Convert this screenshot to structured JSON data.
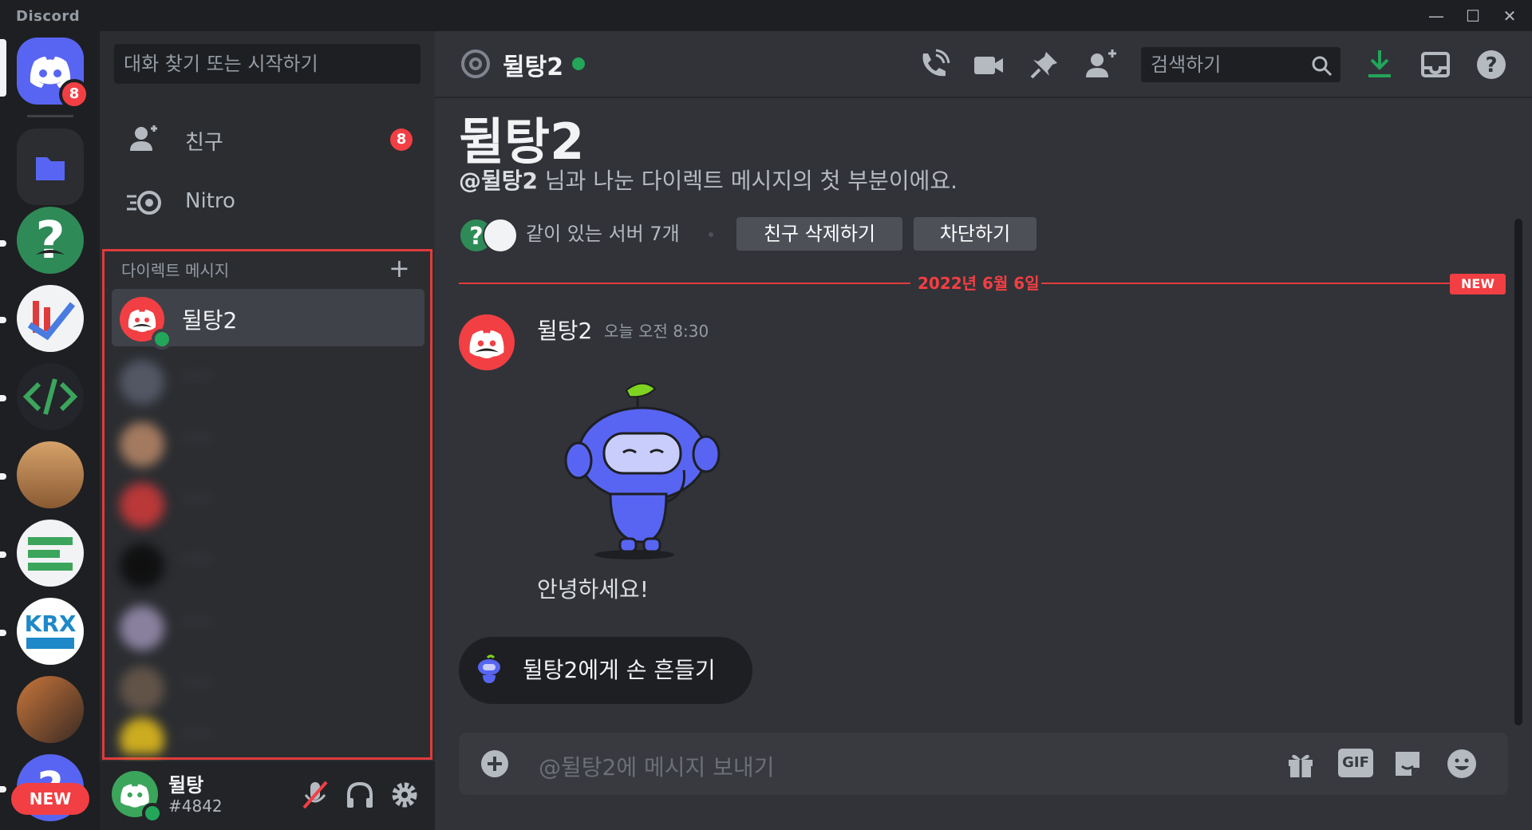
{
  "app": {
    "name": "Discord"
  },
  "window_controls": {
    "minimize": "—",
    "maximize": "☐",
    "close": "✕"
  },
  "servers": {
    "home_badge": "8",
    "new_label": "NEW"
  },
  "sidebar": {
    "search_placeholder": "대화 찾기 또는 시작하기",
    "friends_label": "친구",
    "friends_badge": "8",
    "nitro_label": "Nitro",
    "dm_header": "다이렉트 메시지",
    "dm_add": "+",
    "active_dm": "뒬탕2",
    "blurred_names": [
      "······",
      "······",
      "······",
      "······",
      "······",
      "······",
      "······"
    ]
  },
  "user": {
    "name": "뒬탕",
    "tag": "#4842"
  },
  "header": {
    "channel": "뒬탕2",
    "search_placeholder": "검색하기"
  },
  "profile": {
    "title": "뒬탕2",
    "intro_prefix": "@뒬탕2",
    "intro_suffix": " 님과 나눈 다이렉트 메시지의 첫 부분이에요.",
    "mutual_servers": "같이 있는 서버 7개",
    "remove_friend": "친구 삭제하기",
    "block": "차단하기"
  },
  "divider": {
    "date": "2022년 6월 6일",
    "new_label": "NEW"
  },
  "message": {
    "author": "뒬탕2",
    "time": "오늘 오전 8:30",
    "text": "안녕하세요!"
  },
  "wave": {
    "label": "뒬탕2에게 손 흔들기"
  },
  "composer": {
    "placeholder": "@뒬탕2에 메시지 보내기",
    "gif": "GIF"
  },
  "colors": {
    "brand": "#5865f2",
    "danger": "#f23f43",
    "online": "#23a55a"
  }
}
